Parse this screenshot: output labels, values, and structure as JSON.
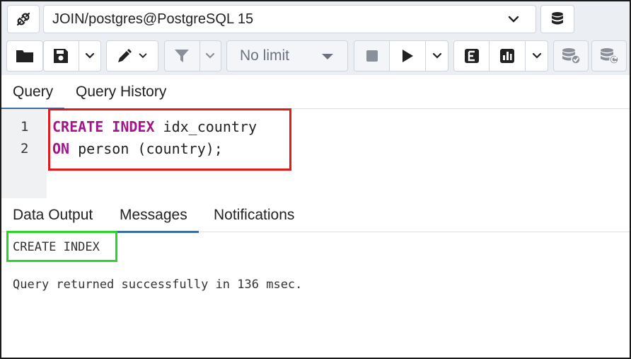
{
  "toolbar": {
    "connection_label": "JOIN/postgres@PostgreSQL 15",
    "limit_label": "No limit",
    "icons": {
      "connection": "plug-icon",
      "db_stack": "database-icon",
      "open": "folder-icon",
      "save": "save-icon",
      "edit": "pen-icon",
      "filter": "filter-icon",
      "stop": "stop-icon",
      "execute": "play-icon",
      "explain": "explain-icon",
      "analyze": "chart-icon",
      "commit": "db-check-icon",
      "rollback": "db-rollback-icon"
    }
  },
  "editor_tabs": {
    "query": "Query",
    "history": "Query History"
  },
  "editor": {
    "lines": [
      {
        "number": "1",
        "keyword": "CREATE INDEX",
        "rest": " idx_country"
      },
      {
        "number": "2",
        "keyword": "ON",
        "rest": " person (country);"
      }
    ]
  },
  "output_tabs": {
    "data_output": "Data Output",
    "messages": "Messages",
    "notifications": "Notifications"
  },
  "messages": {
    "result": "CREATE INDEX",
    "status": "Query returned successfully in 136 msec."
  },
  "colors": {
    "keyword": "#a3158c",
    "highlight_red": "#e11b1b",
    "highlight_green": "#28d62a",
    "tab_active": "#3d6d9c"
  }
}
